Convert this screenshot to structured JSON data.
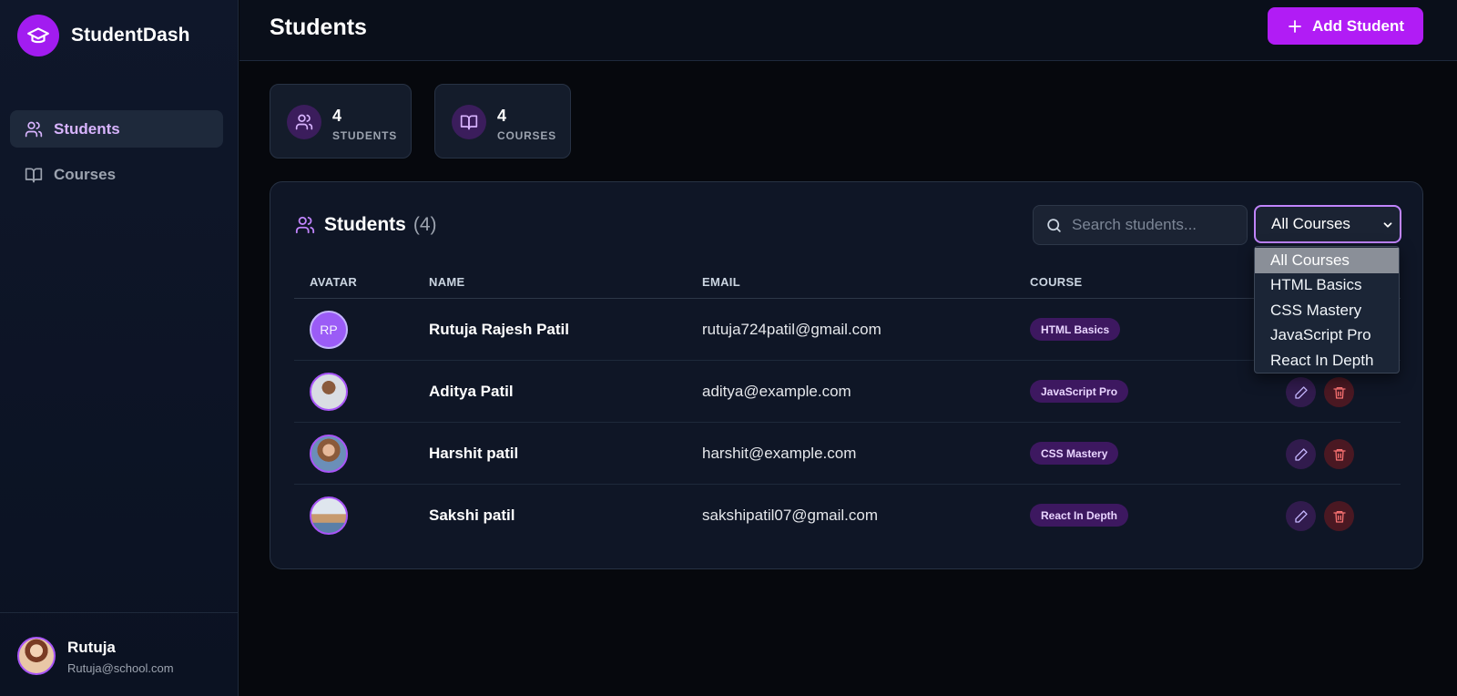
{
  "brand": {
    "name": "StudentDash"
  },
  "sidebar": {
    "items": [
      {
        "label": "Students",
        "icon": "users-icon",
        "active": true
      },
      {
        "label": "Courses",
        "icon": "book-icon",
        "active": false
      }
    ],
    "user": {
      "name": "Rutuja",
      "email": "Rutuja@school.com"
    }
  },
  "header": {
    "title": "Students",
    "add_button": "Add Student"
  },
  "stats": [
    {
      "value": "4",
      "label": "STUDENTS",
      "icon": "users-icon"
    },
    {
      "value": "4",
      "label": "COURSES",
      "icon": "book-icon"
    }
  ],
  "panel": {
    "title": "Students",
    "count": "(4)",
    "search_placeholder": "Search students...",
    "filter_value": "All Courses",
    "filter_options": [
      "All Courses",
      "HTML Basics",
      "CSS Mastery",
      "JavaScript Pro",
      "React In Depth"
    ],
    "columns": [
      "AVATAR",
      "NAME",
      "EMAIL",
      "COURSE"
    ],
    "rows": [
      {
        "initials": "RP",
        "name": "Rutuja Rajesh Patil",
        "email": "rutuja724patil@gmail.com",
        "course": "HTML Basics"
      },
      {
        "name": "Aditya Patil",
        "email": "aditya@example.com",
        "course": "JavaScript Pro"
      },
      {
        "name": "Harshit patil",
        "email": "harshit@example.com",
        "course": "CSS Mastery"
      },
      {
        "name": "Sakshi patil",
        "email": "sakshipatil07@gmail.com",
        "course": "React In Depth"
      }
    ]
  },
  "colors": {
    "accent": "#b11cf5",
    "accent_light": "#d8b4fe",
    "badge_bg": "#3d1860",
    "delete_bg": "#4a1822",
    "background": "#06080d"
  }
}
